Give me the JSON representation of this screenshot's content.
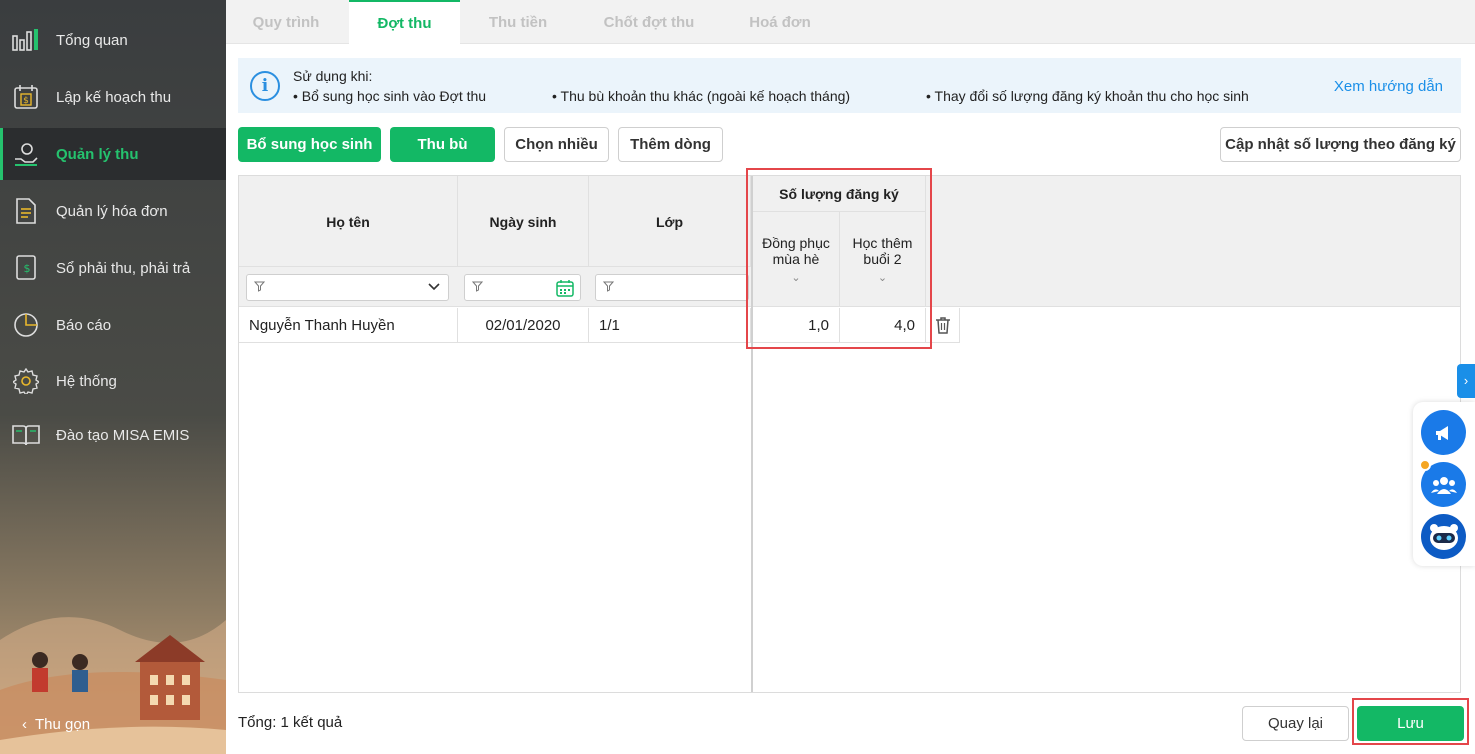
{
  "sidebar": {
    "items": [
      {
        "label": "Tổng quan",
        "icon": "bar-chart-icon"
      },
      {
        "label": "Lập kế hoạch thu",
        "icon": "calendar-money-icon"
      },
      {
        "label": "Quản lý thu",
        "icon": "hand-coin-icon"
      },
      {
        "label": "Quản lý hóa đơn",
        "icon": "document-icon"
      },
      {
        "label": "Sổ phải thu, phải trả",
        "icon": "ledger-icon"
      },
      {
        "label": "Báo cáo",
        "icon": "pie-chart-icon"
      },
      {
        "label": "Hệ thống",
        "icon": "gear-icon"
      },
      {
        "label": "Đào tạo MISA EMIS",
        "icon": "book-icon"
      }
    ],
    "active_index": 2,
    "collapse_label": "Thu gọn"
  },
  "tabs": [
    "Quy trình",
    "Đợt thu",
    "Thu tiền",
    "Chốt đợt thu",
    "Hoá đơn"
  ],
  "active_tab": "Đợt thu",
  "info": {
    "heading": "Sử dụng khi:",
    "bullets": [
      "• Bổ sung học sinh vào Đợt thu",
      "• Thu bù khoản thu khác (ngoài kế hoạch tháng)",
      "• Thay đổi số lượng đăng ký khoản thu cho học sinh"
    ],
    "link": "Xem hướng dẫn"
  },
  "toolbar": {
    "add_student": "Bổ sung học sinh",
    "makeup": "Thu bù",
    "select_many": "Chọn nhiều",
    "add_row": "Thêm dòng",
    "update_qty": "Cập nhật số lượng theo đăng ký"
  },
  "table": {
    "col_name": "Họ tên",
    "col_dob": "Ngày sinh",
    "col_class": "Lớp",
    "group_header": "Số lượng đăng ký",
    "sub1": "Đồng phục mùa hè",
    "sub2": "Học thêm buổi 2",
    "rows": [
      {
        "name": "Nguyễn Thanh Huyền",
        "dob": "02/01/2020",
        "class": "1/1",
        "q1": "1,0",
        "q2": "4,0"
      }
    ]
  },
  "footer": {
    "total": "Tổng: 1 kết quả",
    "back": "Quay lại",
    "save": "Lưu"
  },
  "colors": {
    "primary": "#13b865",
    "accent_blue": "#1a8fe8",
    "highlight": "#e4464a"
  }
}
